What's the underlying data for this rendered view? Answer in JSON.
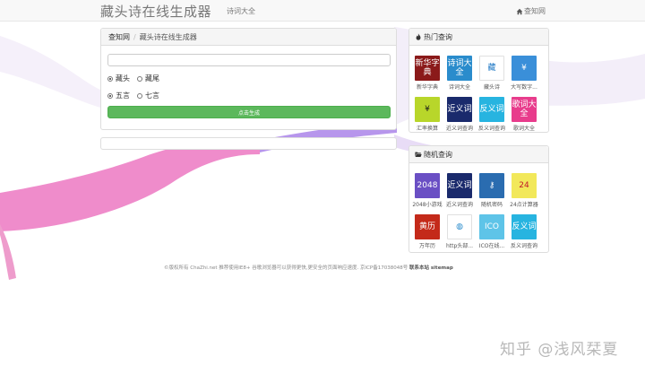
{
  "navbar": {
    "brand": "藏头诗在线生成器",
    "link": "诗词大全",
    "right_link": "查知网"
  },
  "main_panel": {
    "breadcrumb_home": "查知网",
    "breadcrumb_sep": "/",
    "breadcrumb_current": "藏头诗在线生成器",
    "input_value": "",
    "options_position": [
      {
        "label": "藏头",
        "checked": true
      },
      {
        "label": "藏尾",
        "checked": false
      }
    ],
    "options_length": [
      {
        "label": "五言",
        "checked": true
      },
      {
        "label": "七言",
        "checked": false
      }
    ],
    "button_label": "点击生成"
  },
  "hot_panel": {
    "title": "热门查询",
    "tools": [
      {
        "label": "新华字典",
        "icon_text": "新华字典",
        "bg": "#8b1a1a",
        "fg": "#ffffff"
      },
      {
        "label": "诗词大全",
        "icon_text": "诗词大全",
        "bg": "#2a8ccc",
        "fg": "#ffffff"
      },
      {
        "label": "藏头诗",
        "icon_text": "藏",
        "bg": "#ffffff",
        "fg": "#1f78c4"
      },
      {
        "label": "大写数字...",
        "icon_text": "¥",
        "bg": "#3a8fd9",
        "fg": "#ffffff"
      },
      {
        "label": "汇率换算",
        "icon_text": "¥",
        "bg": "#b8d62a",
        "fg": "#1a1a1a"
      },
      {
        "label": "近义词查询",
        "icon_text": "近义词",
        "bg": "#1a2a6c",
        "fg": "#ffffff"
      },
      {
        "label": "反义词查询",
        "icon_text": "反义词",
        "bg": "#27b4e0",
        "fg": "#ffffff"
      },
      {
        "label": "歌词大全",
        "icon_text": "歌词大全",
        "bg": "#e83c8c",
        "fg": "#ffffff"
      }
    ]
  },
  "random_panel": {
    "title": "随机查询",
    "tools": [
      {
        "label": "2048小游戏",
        "icon_text": "2048",
        "bg": "#6a4fc4",
        "fg": "#ffffff"
      },
      {
        "label": "近义词查询",
        "icon_text": "近义词",
        "bg": "#1a2a6c",
        "fg": "#ffffff"
      },
      {
        "label": "随机密码",
        "icon_text": "⚷",
        "bg": "#2a6cb0",
        "fg": "#ffffff"
      },
      {
        "label": "24点计算器",
        "icon_text": "24",
        "bg": "#f2e85a",
        "fg": "#c0182a"
      },
      {
        "label": "万年历",
        "icon_text": "黄历",
        "bg": "#c42a1a",
        "fg": "#ffffff"
      },
      {
        "label": "http头部...",
        "icon_text": "◍",
        "bg": "#ffffff",
        "fg": "#2a8ccc"
      },
      {
        "label": "ICO在线...",
        "icon_text": "ICO",
        "bg": "#5ec4e8",
        "fg": "#ffffff"
      },
      {
        "label": "反义词查询",
        "icon_text": "反义词",
        "bg": "#27b4e0",
        "fg": "#ffffff"
      }
    ]
  },
  "footer": {
    "text": "©版权所有 ChaZhi.net 推荐使用IE8+ 谷歌浏览器可以获得更快,更安全的页面响应速度.",
    "icp": "京ICP备17038048号",
    "links": "联系本站 sitemap"
  },
  "watermark": "知乎 @浅风栞夏",
  "colors": {
    "button": "#5cb85c",
    "ribbon_purple": "#b090e8",
    "ribbon_pink": "#ee8cc8",
    "ribbon_light": "#f2ecf8"
  }
}
